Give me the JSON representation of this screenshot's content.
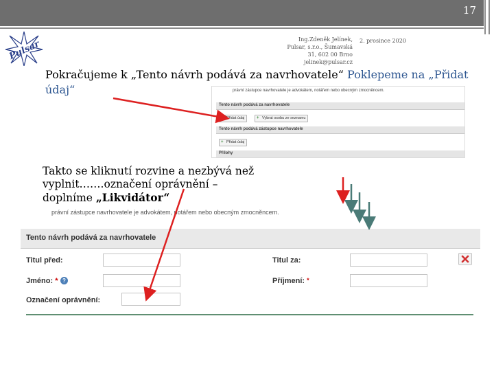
{
  "slide": {
    "number": "17"
  },
  "author": {
    "lines": [
      "Ing.Zdeněk Jelínek,",
      "Pulsar, s.r.o., Šumavská",
      "31, 602 00 Brno",
      "jelinek@pulsar.cz"
    ],
    "date": "2. prosince 2020"
  },
  "logo": {
    "text": "Pulsar"
  },
  "heading": {
    "part1": "Pokračujeme k „Tento návrh podává za navrhovatele“ ",
    "part2": "Poklepeme na „Přidat",
    "part3": "údaj“"
  },
  "explanation": {
    "line1": "Takto se kliknutí rozvine a nezbývá než",
    "line2": "vyplnit…….označení oprávnění –",
    "line3": "doplníme ",
    "bold": "„Likvidátor“"
  },
  "screenshot1": {
    "note": "právní zástupce navrhovatele je advokátem, notářem nebo obecným zmocněncem.",
    "section1_title": "Tento návrh podává za navrhovatele",
    "section2_title": "Tento návrh podává zástupce navrhovatele",
    "add_button": "Přidat údaj",
    "select_button": "Vybrat osobu ze seznamu",
    "section3_title": "Přílohy"
  },
  "screenshot2": {
    "note": "právní zástupce navrhovatele je advokátem, notářem nebo obecným zmocněncem.",
    "panel_title": "Tento návrh podává za navrhovatele",
    "title_before_label": "Titul před:",
    "title_after_label": "Titul za:",
    "first_name_label": "Jméno:",
    "last_name_label": "Příjmení:",
    "authorization_label": "Označení oprávnění:",
    "required_mark": "*",
    "help_mark": "?",
    "close_mark": "✕"
  },
  "colors": {
    "arrow_red": "#dd2020",
    "arrow_teal": "#4a7b77",
    "heading_accent": "#2c5590"
  },
  "icons": {
    "help": "question-icon",
    "close": "close-icon",
    "add": "plus-icon"
  }
}
